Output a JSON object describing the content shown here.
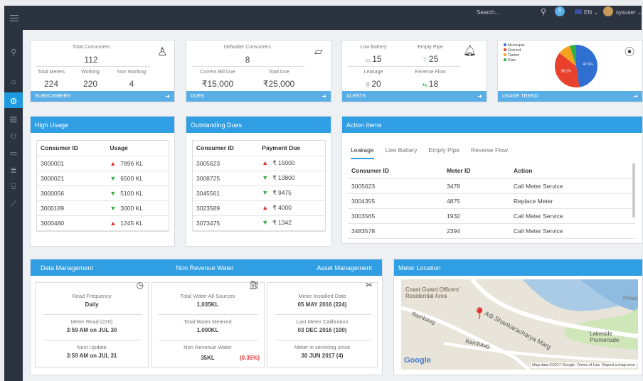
{
  "topbar": {
    "search_placeholder": "Search...",
    "language": "EN",
    "user": "sysuser",
    "notif_count": "5"
  },
  "subscribers": {
    "total_label": "Total Consumers",
    "total": "112",
    "meters_label": "Total Meters",
    "meters": "224",
    "working_label": "Working",
    "working": "220",
    "nonworking_label": "Non Working",
    "nonworking": "4",
    "footer": "SUBSCRIBERS"
  },
  "dues": {
    "defaulter_label": "Defaulter Consumers",
    "defaulter": "8",
    "current_label": "Current Bill Due",
    "current": "₹15,000",
    "total_label": "Total Due",
    "total": "₹25,000",
    "footer": "DUES"
  },
  "alerts": {
    "low_battery_label": "Low Battery",
    "low_battery": "15",
    "empty_pipe_label": "Empty Pipe",
    "empty_pipe": "25",
    "leakage_label": "Leakage",
    "leakage": "20",
    "reverse_label": "Reverse Flow",
    "reverse": "18",
    "footer": "ALERTS"
  },
  "usage_trend": {
    "footer": "USAGE TREND",
    "legend": [
      "Municipal",
      "Ground",
      "Tanker",
      "Rain"
    ],
    "colors": [
      "#2f6fd1",
      "#e8412e",
      "#f4a21f",
      "#2fb040"
    ],
    "slices": [
      47.6,
      38.1,
      9.5,
      4.8
    ],
    "labels": [
      "47.6%",
      "38.1%"
    ]
  },
  "high_usage": {
    "title": "High Usage",
    "col1": "Consumer ID",
    "col2": "Usage",
    "rows": [
      {
        "id": "3000001",
        "usage": "7896 KL",
        "dir": "up"
      },
      {
        "id": "3000021",
        "usage": "6500 KL",
        "dir": "down"
      },
      {
        "id": "3000056",
        "usage": "5100 KL",
        "dir": "down"
      },
      {
        "id": "3000189",
        "usage": "3000 KL",
        "dir": "down"
      },
      {
        "id": "3000480",
        "usage": "1245 KL",
        "dir": "up"
      }
    ]
  },
  "outstanding": {
    "title": "Outstanding Dues",
    "col1": "Consumer ID",
    "col2": "Payment Due",
    "rows": [
      {
        "id": "3005623",
        "due": "₹ 15000",
        "dir": "up"
      },
      {
        "id": "3008725",
        "due": "₹ 13800",
        "dir": "down"
      },
      {
        "id": "3045561",
        "due": "₹ 9475",
        "dir": "down"
      },
      {
        "id": "3023589",
        "due": "₹ 4000",
        "dir": "up"
      },
      {
        "id": "3073475",
        "due": "₹ 1342",
        "dir": "down"
      }
    ]
  },
  "actions": {
    "title": "Action Items",
    "tabs": [
      "Leakage",
      "Low Battery",
      "Empty Pipe",
      "Reverse Flow"
    ],
    "col1": "Consumer ID",
    "col2": "Meter ID",
    "col3": "Action",
    "rows": [
      {
        "cid": "3005623",
        "mid": "3478",
        "action": "Call Meter Service"
      },
      {
        "cid": "3004355",
        "mid": "4875",
        "action": "Replace Meter"
      },
      {
        "cid": "3003565",
        "mid": "1932",
        "action": "Call Meter Service"
      },
      {
        "cid": "3483578",
        "mid": "2394",
        "action": "Call Meter Service"
      }
    ]
  },
  "data_mgmt": {
    "title": "Data Management",
    "read_freq_label": "Read Frequency",
    "read_freq": "Daily",
    "meter_read_label": "Meter Read (220)",
    "meter_read": "3:59 AM on JUL 30",
    "next_update_label": "Next Update",
    "next_update": "3:59 AM on JUL 31"
  },
  "nrw": {
    "title": "Non Revenue Water",
    "total_label": "Total Water All Sources",
    "total": "1,035KL",
    "metered_label": "Total Water Metered",
    "metered": "1,000KL",
    "nrw_label": "Non Revenue Water",
    "nrw": "35KL",
    "nrw_pct": "(0.35%)"
  },
  "asset": {
    "title": "Asset Management",
    "installed_label": "Meter Installed Date",
    "installed": "05 MAY 2016 (224)",
    "calib_label": "Last Meter Calibration",
    "calib": "03 DEC 2016 (100)",
    "servicing_label": "Meter in servicing since",
    "servicing": "30 JUN 2017 (4)"
  },
  "map": {
    "title": "Meter Location",
    "place1": "Coast Guard Officers' Residential Area",
    "road1": "Adi Shankaracharya Marg",
    "road2": "Rambaug",
    "road3": "Lakeside Promenade",
    "road4": "Powa",
    "logo": "Google",
    "attrib": "Map data ©2017 Google",
    "terms": "Terms of Use",
    "report": "Report a map error"
  }
}
